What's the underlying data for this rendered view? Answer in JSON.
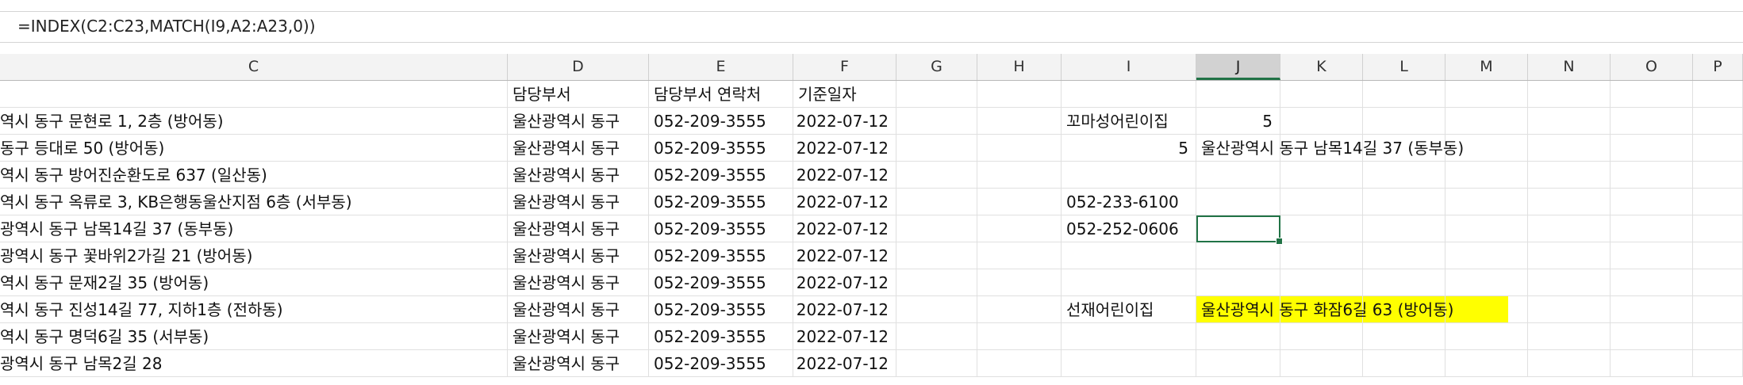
{
  "formula_bar": {
    "formula": "=INDEX(C2:C23,MATCH(I9,A2:A23,0))"
  },
  "columns": [
    "C",
    "D",
    "E",
    "F",
    "G",
    "H",
    "I",
    "J",
    "K",
    "L",
    "M",
    "N",
    "O",
    "P"
  ],
  "selected_column": "J",
  "header_row": {
    "D": "담당부서",
    "E": "담당부서 연락처",
    "F": "기준일자"
  },
  "rows": [
    {
      "C": "역시 동구 문현로 1, 2층 (방어동)",
      "D": "울산광역시 동구",
      "E": "052-209-3555",
      "F": "2022-07-12",
      "I": "꼬마성어린이집",
      "J": "5"
    },
    {
      "C": "동구 등대로 50 (방어동)",
      "D": "울산광역시 동구",
      "E": "052-209-3555",
      "F": "2022-07-12",
      "I": "5",
      "J": "울산광역시 동구 남목14길 37 (동부동)"
    },
    {
      "C": "역시 동구 방어진순환도로 637 (일산동)",
      "D": "울산광역시 동구",
      "E": "052-209-3555",
      "F": "2022-07-12"
    },
    {
      "C": "역시 동구 옥류로 3, KB은행동울산지점 6층 (서부동)",
      "D": "울산광역시 동구",
      "E": "052-209-3555",
      "F": "2022-07-12",
      "I": "052-233-6100"
    },
    {
      "C": "광역시 동구 남목14길 37 (동부동)",
      "D": "울산광역시 동구",
      "E": "052-209-3555",
      "F": "2022-07-12",
      "I": "052-252-0606"
    },
    {
      "C": "광역시 동구 꽃바위2가길 21 (방어동)",
      "D": "울산광역시 동구",
      "E": "052-209-3555",
      "F": "2022-07-12"
    },
    {
      "C": "역시 동구  문재2길 35 (방어동)",
      "D": "울산광역시 동구",
      "E": "052-209-3555",
      "F": "2022-07-12"
    },
    {
      "C": "역시 동구 진성14길 77, 지하1층 (전하동)",
      "D": "울산광역시 동구",
      "E": "052-209-3555",
      "F": "2022-07-12",
      "I": "선재어린이집",
      "J": "울산광역시 동구  화잠6길 63 (방어동)"
    },
    {
      "C": "역시 동구  명덕6길 35 (서부동)",
      "D": "울산광역시 동구",
      "E": "052-209-3555",
      "F": "2022-07-12"
    },
    {
      "C": "광역시 동구 남목2길 28",
      "D": "울산광역시 동구",
      "E": "052-209-3555",
      "F": "2022-07-12"
    }
  ],
  "colors": {
    "accent": "#217346",
    "highlight": "#ffff00"
  }
}
